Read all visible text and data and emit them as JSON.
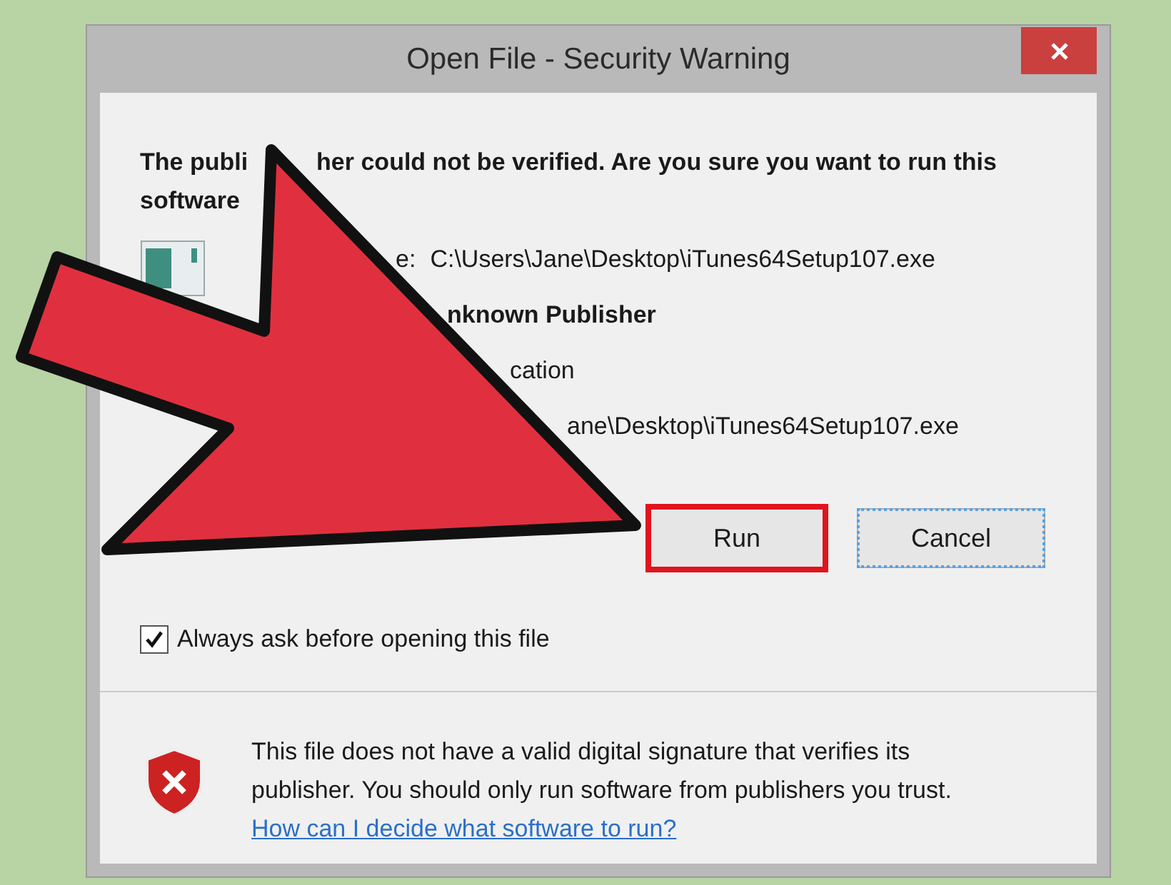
{
  "window": {
    "title": "Open File - Security Warning"
  },
  "heading": {
    "line_1_start": "The publi",
    "line_1_end": "her could not be verified.  Are you sure you want to run this",
    "line_2": "software"
  },
  "details": [
    {
      "kind": "path",
      "label": "e:",
      "value": "C:\\Users\\Jane\\Desktop\\iTunes64Setup107.exe"
    },
    {
      "kind": "publisher",
      "value": "nknown Publisher"
    },
    {
      "kind": "type",
      "value": "cation"
    },
    {
      "kind": "path",
      "value": "ane\\Desktop\\iTunes64Setup107.exe"
    }
  ],
  "buttons": [
    {
      "label": "Run",
      "highlighted": true,
      "focused": false
    },
    {
      "label": "Cancel",
      "highlighted": false,
      "focused": true
    }
  ],
  "checkbox": {
    "label": "Always ask before opening this file",
    "checked": true
  },
  "warning": {
    "text": "This file does not have a valid digital signature that verifies its publisher.  You should only run software from publishers you trust.",
    "link": "How can I decide what software to run?"
  }
}
